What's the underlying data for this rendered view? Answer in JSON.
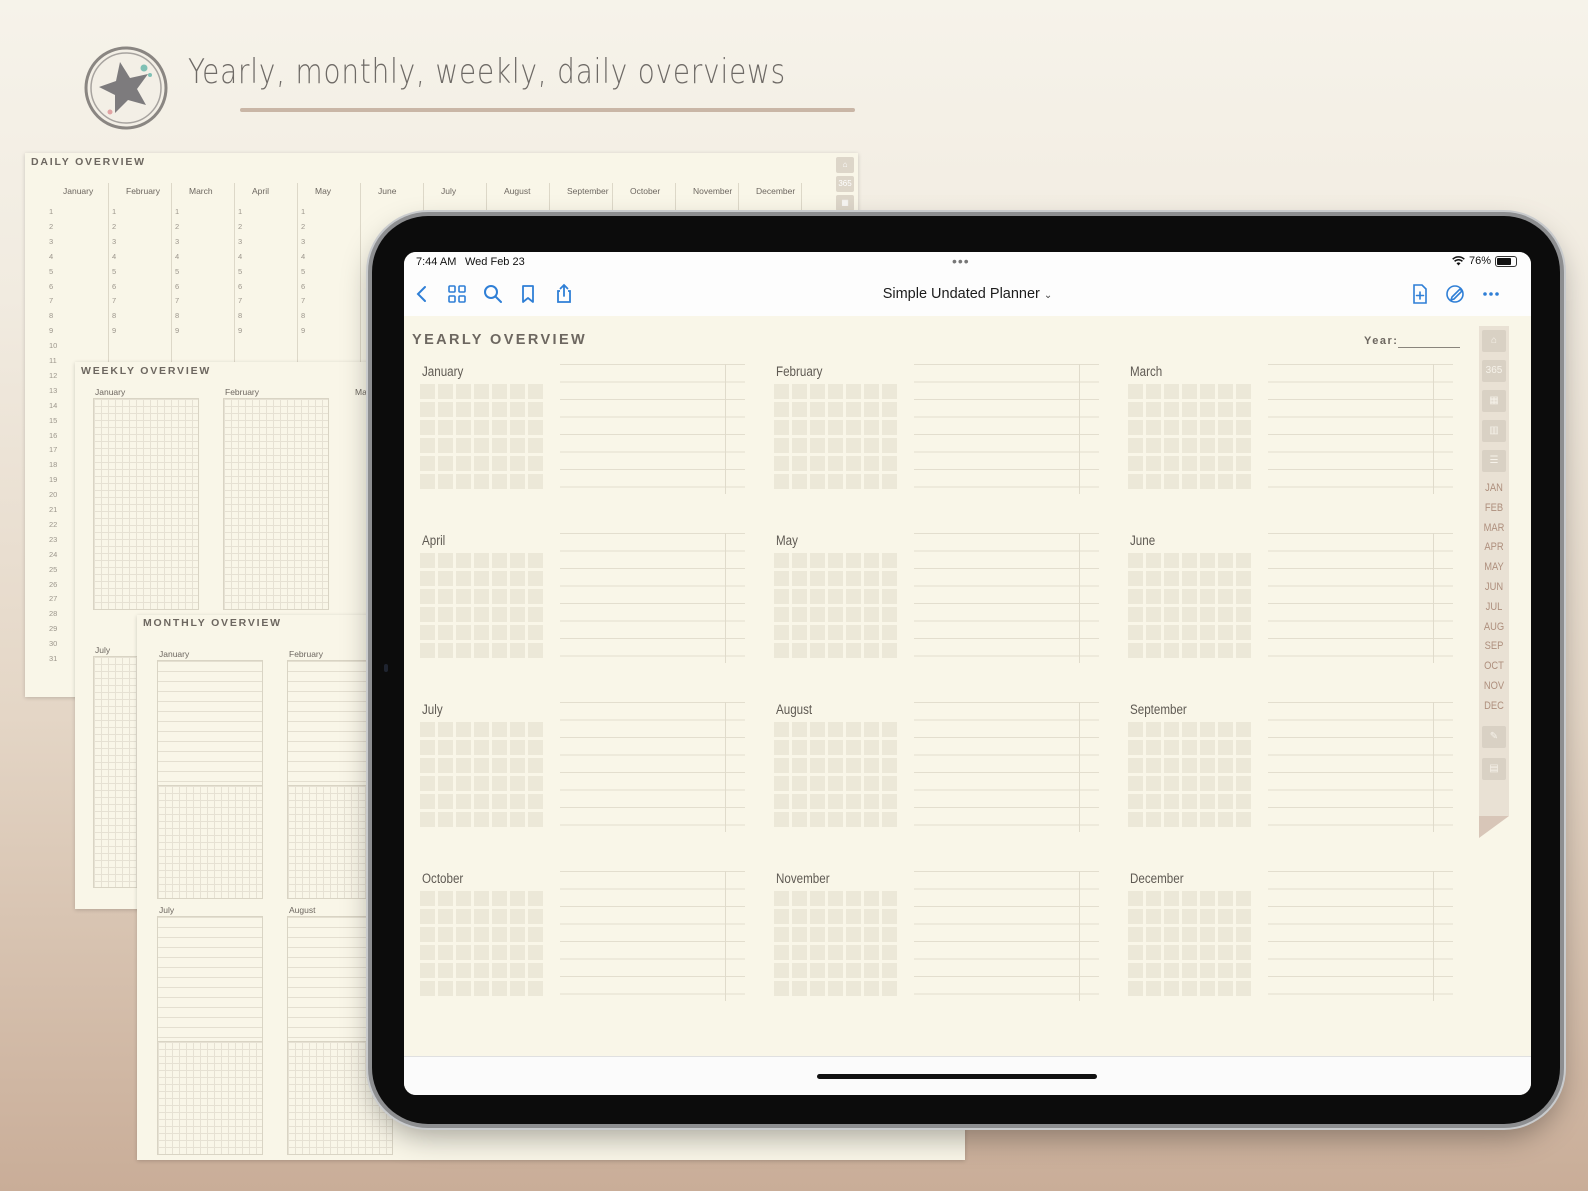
{
  "headline": "Yearly, monthly, weekly, daily overviews",
  "daily_sheet": {
    "title": "DAILY OVERVIEW",
    "months": [
      "January",
      "February",
      "March",
      "April",
      "May",
      "June",
      "July",
      "August",
      "September",
      "October",
      "November",
      "December"
    ],
    "days": [
      "1",
      "2",
      "3",
      "4",
      "5",
      "6",
      "7",
      "8",
      "9",
      "10",
      "11",
      "12",
      "13",
      "14",
      "15",
      "16",
      "17",
      "18",
      "19",
      "20",
      "21",
      "22",
      "23",
      "24",
      "25",
      "26",
      "27",
      "28",
      "29",
      "30",
      "31"
    ],
    "tab_label": "365"
  },
  "weekly_sheet": {
    "title": "WEEKLY OVERVIEW",
    "months": [
      "January",
      "February",
      "Ma"
    ],
    "second_row_month": "July"
  },
  "monthly_sheet": {
    "title": "MONTHLY OVERVIEW",
    "months_top": [
      "January",
      "February"
    ],
    "months_bottom": [
      "July",
      "August"
    ]
  },
  "statusbar": {
    "time": "7:44 AM",
    "date": "Wed Feb 23",
    "multitask_dots": "•••",
    "battery": "76%",
    "battery_level": 0.76
  },
  "toolbar": {
    "title": "Simple Undated Planner",
    "title_chevron": "⌄",
    "icons": [
      "back-icon",
      "thumbnails-icon",
      "search-icon",
      "bookmark-icon",
      "share-icon",
      "add-page-icon",
      "annotate-icon",
      "more-icon"
    ]
  },
  "page": {
    "title": "YEARLY OVERVIEW",
    "year_label": "Year:",
    "months": [
      "January",
      "February",
      "March",
      "April",
      "May",
      "June",
      "July",
      "August",
      "September",
      "October",
      "November",
      "December"
    ]
  },
  "side_tabs": {
    "tab_365": "365",
    "months": [
      "JAN",
      "FEB",
      "MAR",
      "APR",
      "MAY",
      "JUN",
      "JUL",
      "AUG",
      "SEP",
      "OCT",
      "NOV",
      "DEC"
    ]
  },
  "colors": {
    "accent": "#2f7fd6",
    "paper": "#f9f6e8",
    "tab_month": "#ae8f7d"
  }
}
